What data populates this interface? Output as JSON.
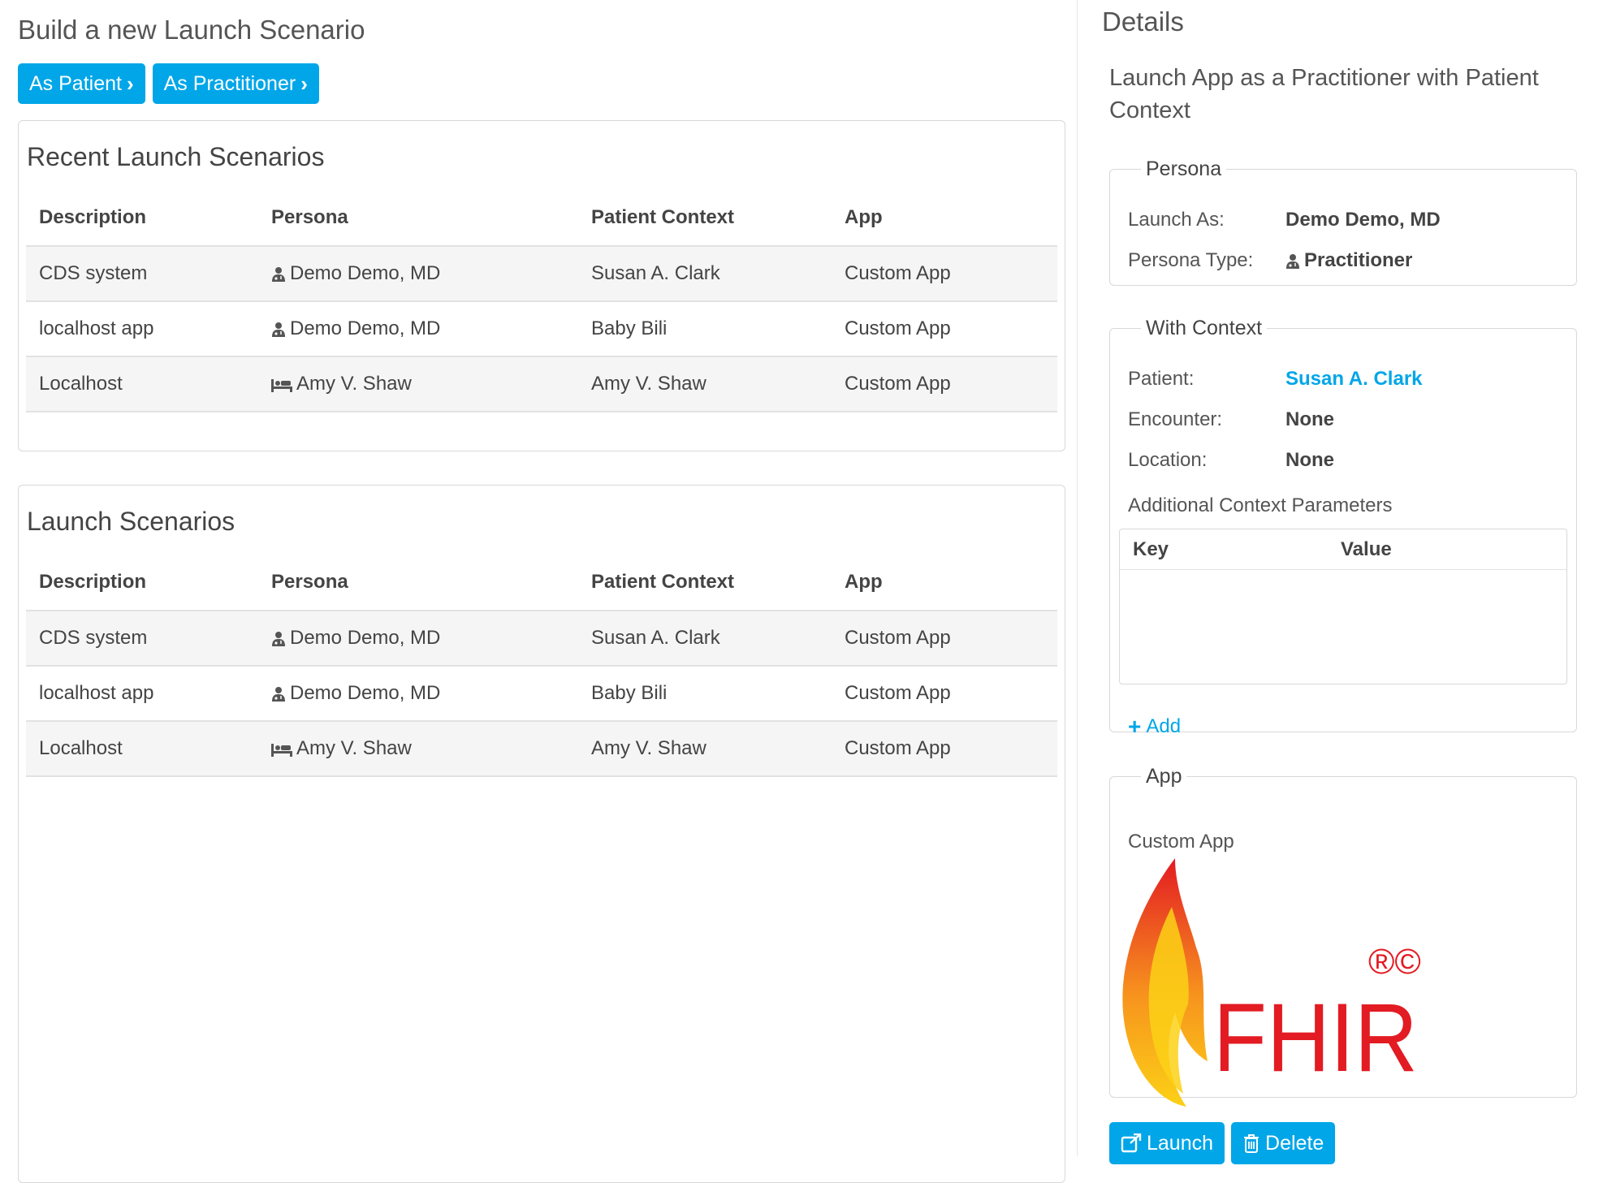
{
  "page": {
    "title": "Build a new Launch Scenario",
    "buttons": {
      "as_patient": "As Patient",
      "as_practitioner": "As Practitioner"
    }
  },
  "recent": {
    "heading": "Recent Launch Scenarios",
    "columns": [
      "Description",
      "Persona",
      "Patient Context",
      "App"
    ],
    "rows": [
      {
        "description": "CDS system",
        "persona": "Demo Demo, MD",
        "persona_icon": "practitioner-icon",
        "patient": "Susan A. Clark",
        "app": "Custom App"
      },
      {
        "description": "localhost app",
        "persona": "Demo Demo, MD",
        "persona_icon": "practitioner-icon",
        "patient": "Baby Bili",
        "app": "Custom App"
      },
      {
        "description": "Localhost",
        "persona": "Amy V. Shaw",
        "persona_icon": "bed-icon",
        "patient": "Amy V. Shaw",
        "app": "Custom App"
      }
    ]
  },
  "all": {
    "heading": "Launch Scenarios",
    "columns": [
      "Description",
      "Persona",
      "Patient Context",
      "App"
    ],
    "rows": [
      {
        "description": "CDS system",
        "persona": "Demo Demo, MD",
        "persona_icon": "practitioner-icon",
        "patient": "Susan A. Clark",
        "app": "Custom App"
      },
      {
        "description": "localhost app",
        "persona": "Demo Demo, MD",
        "persona_icon": "practitioner-icon",
        "patient": "Baby Bili",
        "app": "Custom App"
      },
      {
        "description": "Localhost",
        "persona": "Amy V. Shaw",
        "persona_icon": "bed-icon",
        "patient": "Amy V. Shaw",
        "app": "Custom App"
      }
    ]
  },
  "details": {
    "title": "Details",
    "description": "Launch App as a Practitioner with Patient Context",
    "persona": {
      "legend": "Persona",
      "launch_as_label": "Launch As:",
      "launch_as_value": "Demo Demo, MD",
      "type_label": "Persona Type:",
      "type_value": "Practitioner"
    },
    "context": {
      "legend": "With Context",
      "patient_label": "Patient:",
      "patient_value": "Susan A. Clark",
      "encounter_label": "Encounter:",
      "encounter_value": "None",
      "location_label": "Location:",
      "location_value": "None",
      "additional_label": "Additional Context Parameters",
      "key_header": "Key",
      "value_header": "Value",
      "add_label": "Add"
    },
    "app": {
      "legend": "App",
      "name": "Custom App",
      "logo_text": "FHIR",
      "logo_marks": "®©"
    },
    "buttons": {
      "launch": "Launch",
      "delete": "Delete"
    }
  },
  "colors": {
    "accent": "#00a6e8",
    "flame_red": "#e31b23",
    "flame_orange": "#f7931e",
    "flame_yellow": "#fcd116"
  }
}
